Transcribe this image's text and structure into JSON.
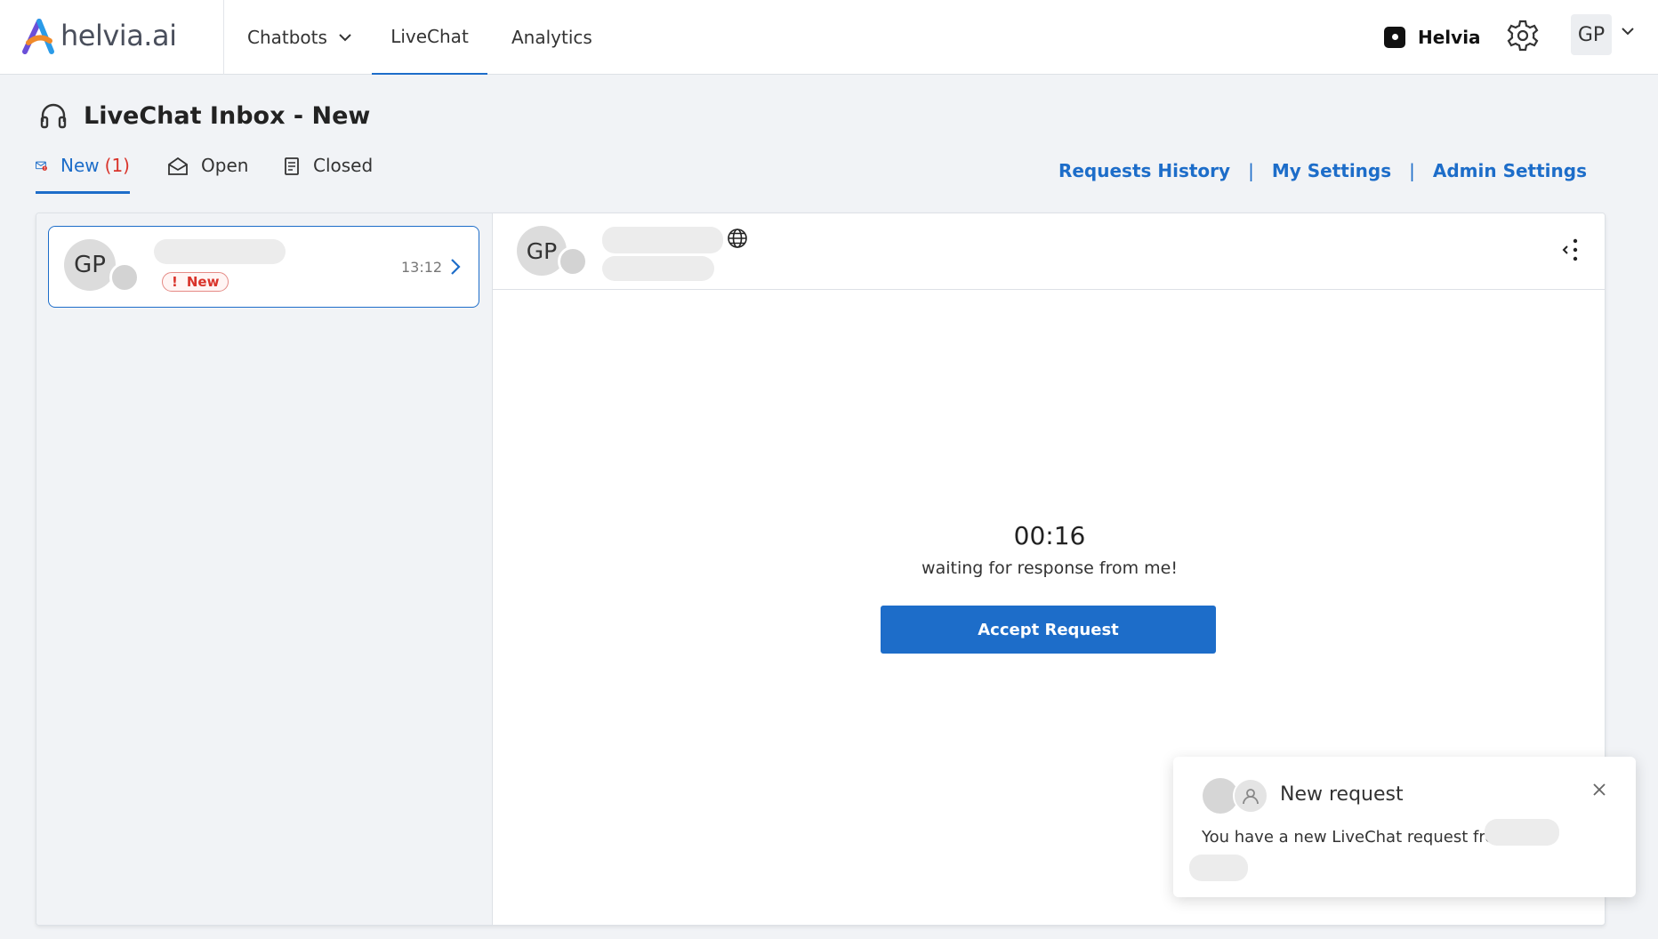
{
  "brand": {
    "name": "helvia.ai"
  },
  "nav": {
    "items": [
      {
        "label": "Chatbots",
        "has_dropdown": true
      },
      {
        "label": "LiveChat",
        "active": true
      },
      {
        "label": "Analytics"
      }
    ]
  },
  "account": {
    "org_name": "Helvia",
    "user_initials": "GP"
  },
  "page": {
    "title": "LiveChat Inbox - New"
  },
  "tabs": [
    {
      "label": "New",
      "count": "(1)",
      "active": true
    },
    {
      "label": "Open"
    },
    {
      "label": "Closed"
    }
  ],
  "links": [
    "Requests History",
    "My Settings",
    "Admin Settings"
  ],
  "conversation": {
    "initials": "GP",
    "badge": "New",
    "badge_icon": "!",
    "time": "13:12"
  },
  "chat_header": {
    "initials": "GP"
  },
  "waiting": {
    "timer": "00:16",
    "message": "waiting for response from me!",
    "accept_label": "Accept Request"
  },
  "toast": {
    "title": "New request",
    "body": "You have a new LiveChat request from"
  },
  "colors": {
    "accent": "#1d6dc9",
    "alert": "#d9342b",
    "background": "#f1f3f6"
  }
}
